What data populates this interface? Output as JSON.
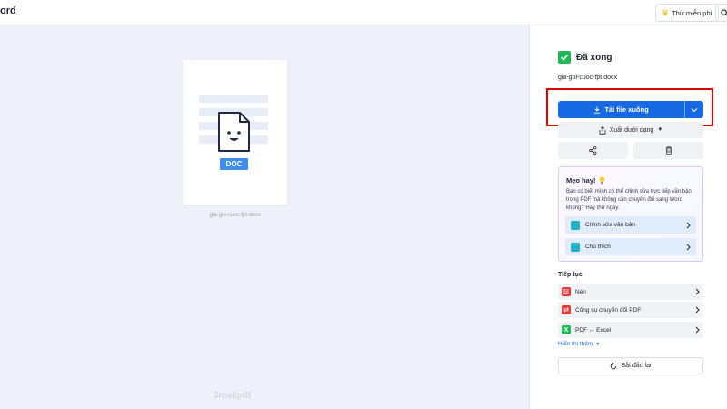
{
  "header": {
    "brand": "ord",
    "trial_label": "Thử miễn phí",
    "trial_icon": "crown-icon",
    "search_icon": "search-icon"
  },
  "preview": {
    "doc_badge": "DOC",
    "file_caption": "gia-goi-cuoc-fpt.docx",
    "watermark": "Smallpdf"
  },
  "panel": {
    "status_title": "Đã xong",
    "filename": "gia-goi-cuoc-fpt.docx",
    "download_label": "Tải file xuống",
    "export_label": "Xuất dưới dạng",
    "tip": {
      "title": "Mẹo hay!",
      "text": "Bạn có biết mình có thể chỉnh sửa trực tiếp văn bản trong PDF mà không cần chuyển đổi sang Word không? Hãy thử ngay:",
      "items": [
        {
          "label": "Chỉnh sửa văn bản",
          "icon": "edit-text-icon"
        },
        {
          "label": "Chú thích",
          "icon": "annotate-icon"
        }
      ]
    },
    "continue_title": "Tiếp tục",
    "continue_items": [
      {
        "label": "Nén",
        "icon": "compress-icon",
        "color": "#e53935"
      },
      {
        "label": "Công cụ chuyển đổi PDF",
        "icon": "convert-icon",
        "color": "#e53935"
      },
      {
        "label": "PDF ↔ Excel",
        "icon": "excel-icon",
        "color": "#1db954"
      }
    ],
    "show_more": "Hiển thị thêm",
    "restart_label": "Bắt đầu lại"
  },
  "colors": {
    "primary": "#1668e3",
    "success": "#1db954",
    "highlight": "#e60000",
    "preview_bg": "#eef1f9"
  }
}
